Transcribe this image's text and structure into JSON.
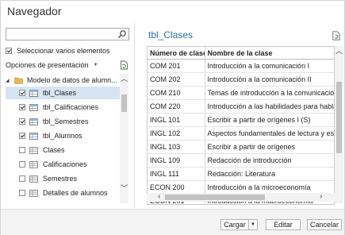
{
  "window": {
    "title": "Navegador"
  },
  "left": {
    "search": {
      "value": "",
      "placeholder": ""
    },
    "select_multiple": {
      "label": "Seleccionar varios elementos",
      "checked": true
    },
    "display_options": {
      "label": "Opciones de presentación"
    },
    "tree": {
      "root": "Modelo de datos de alumn...",
      "items": [
        {
          "label": "tbl_Clases",
          "checked": true,
          "active": true
        },
        {
          "label": "tbl_Calificaciones",
          "checked": true
        },
        {
          "label": "tbl_Semestres",
          "checked": true
        },
        {
          "label": "tbl_Alumnos",
          "checked": true
        },
        {
          "label": "Clases",
          "checked": false
        },
        {
          "label": "Calificaciones",
          "checked": false
        },
        {
          "label": "Semestres",
          "checked": false
        },
        {
          "label": "Detalles de alumnos",
          "checked": false
        }
      ]
    }
  },
  "preview": {
    "title": "tbl_Clases",
    "columns": [
      "Número de clase",
      "Nombre de la clase"
    ],
    "rows": [
      [
        "COM 201",
        "Introducción a la comunicación I"
      ],
      [
        "COM 202",
        "Introducción a la comunicación II"
      ],
      [
        "COM 210",
        "Temas de introducción a la comunicación"
      ],
      [
        "COM 220",
        "Introducción a las habilidades para hablar en"
      ],
      [
        "INGL 101",
        "Escribir a partir de orígenes I (S)"
      ],
      [
        "INGL 102",
        "Aspectos fundamentales de lectura y escritura"
      ],
      [
        "INGL 103",
        "Escribir a partir de orígenes"
      ],
      [
        "INGL 109",
        "Redacción de introducción"
      ],
      [
        "INGL 111",
        "Redacción: Literatura"
      ],
      [
        "ECON 200",
        "Introducción a la microeconomía"
      ],
      [
        "ECON 201",
        "Introducción a la macroeconomía"
      ]
    ]
  },
  "footer": {
    "load": "Cargar",
    "edit": "Editar",
    "cancel": "Cancelar"
  },
  "colors": {
    "accent": "#2e6fa8",
    "selection": "#d6e4f3",
    "footer_bg": "#f3f3f3"
  }
}
